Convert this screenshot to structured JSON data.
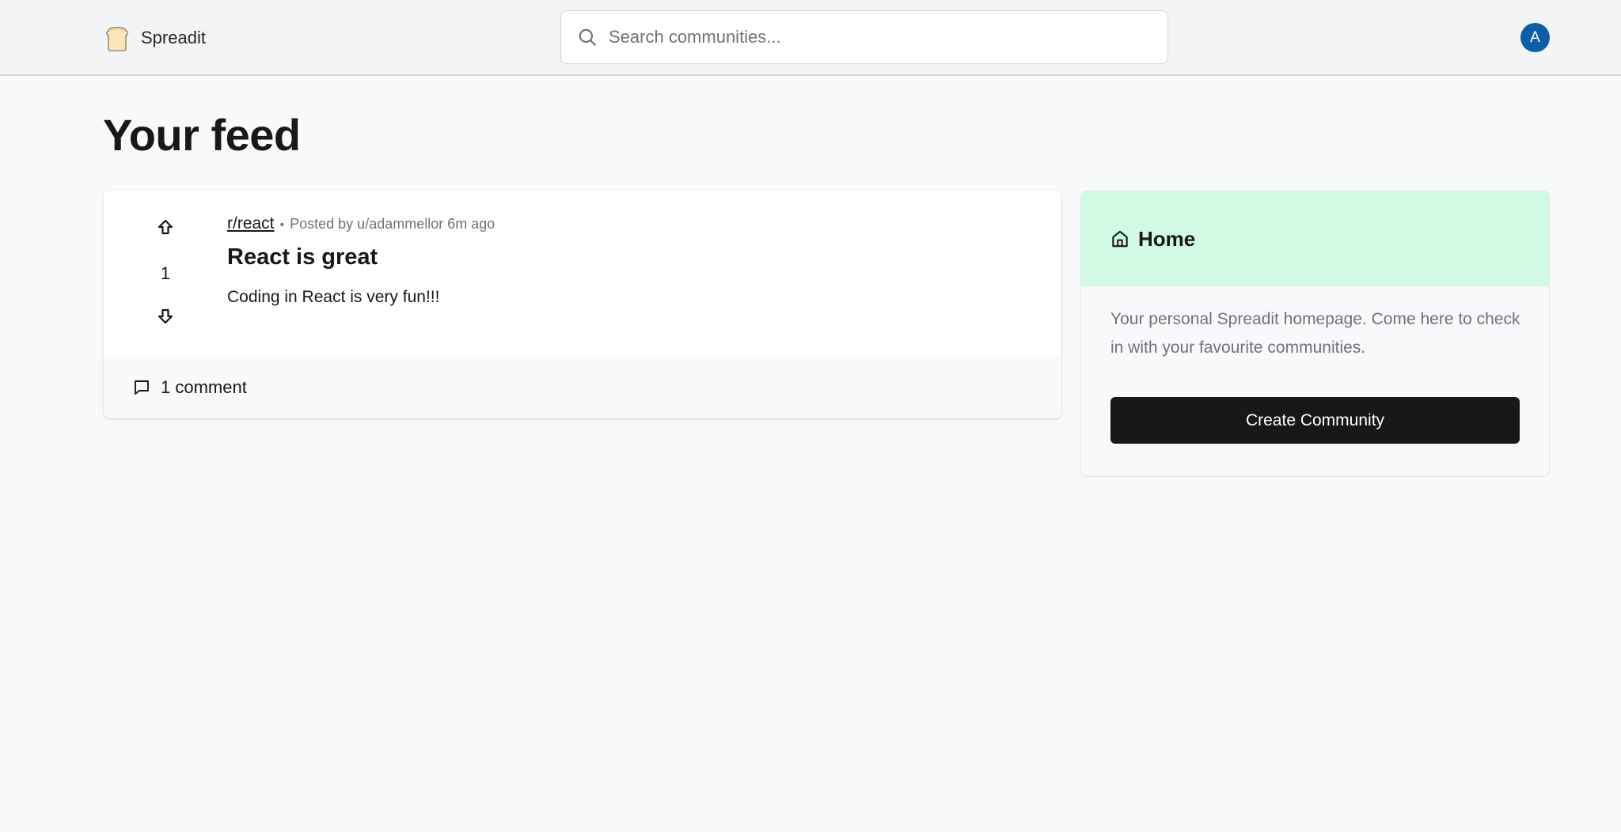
{
  "header": {
    "brand_name": "Spreadit",
    "brand_icon": "bread-slice-icon",
    "search_placeholder": "Search communities...",
    "search_value": "",
    "avatar_initial": "A",
    "avatar_color": "#0d5ea8"
  },
  "main": {
    "title": "Your feed",
    "posts": [
      {
        "subreddit": "r/react",
        "meta": "Posted by u/adammellor 6m ago",
        "votes": "1",
        "title": "React is great",
        "body": "Coding in React is very fun!!!",
        "comments_label": "1 comment"
      }
    ]
  },
  "sidebar": {
    "title": "Home",
    "description": "Your personal Spreadit homepage. Come here to check in with your favourite communities.",
    "create_label": "Create Community",
    "header_color": "#d1fae5"
  }
}
